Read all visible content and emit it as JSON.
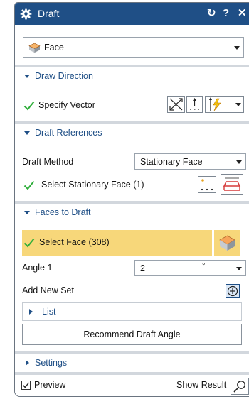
{
  "window": {
    "title": "Draft",
    "reset_glyph": "↻",
    "help_glyph": "?",
    "close_glyph": "✕"
  },
  "type": {
    "value": "Face"
  },
  "draw_direction": {
    "title": "Draw Direction",
    "specify_vector_label": "Specify Vector"
  },
  "draft_references": {
    "title": "Draft References",
    "draft_method_label": "Draft Method",
    "draft_method_value": "Stationary Face",
    "select_stationary_face_label": "Select Stationary Face (1)"
  },
  "faces_to_draft": {
    "title": "Faces to Draft",
    "select_face_label": "Select Face (308)",
    "angle_label": "Angle 1",
    "angle_value": "2",
    "angle_unit": "°",
    "add_new_set_label": "Add New Set",
    "list_label": "List",
    "recommend_button_label": "Recommend Draft Angle"
  },
  "settings": {
    "title": "Settings"
  },
  "footer": {
    "preview_label": "Preview",
    "preview_checked": true,
    "show_result_label": "Show Result"
  },
  "colors": {
    "title_bar": "#1f4f86",
    "highlight": "#f7d77a",
    "check_green": "#2fae3a",
    "group_title": "#1f4f86"
  }
}
